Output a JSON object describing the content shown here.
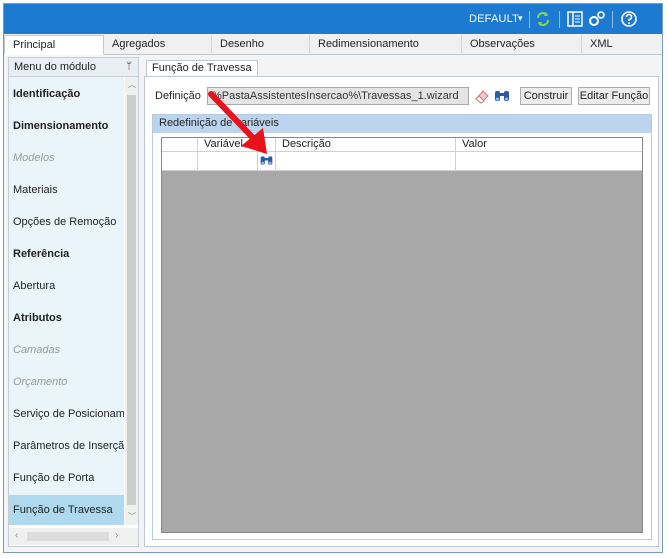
{
  "titlebar": {
    "profile": "DEFAULT",
    "caret": "▾",
    "icons": [
      "refresh-icon",
      "panel-icon",
      "settings-icon",
      "help-icon"
    ],
    "accent": "#1d7ad1"
  },
  "tabs": [
    {
      "label": "Principal",
      "active": true
    },
    {
      "label": "Agregados"
    },
    {
      "label": "Desenho"
    },
    {
      "label": "Redimensionamento"
    },
    {
      "label": "Observações"
    },
    {
      "label": "XML"
    }
  ],
  "sidebar": {
    "title": "Menu do módulo",
    "pin": "ᛘ",
    "items": [
      {
        "label": "Identificação",
        "style": "bold"
      },
      {
        "label": "Dimensionamento",
        "style": "bold"
      },
      {
        "label": "Modelos",
        "style": "disabled"
      },
      {
        "label": "Materiais"
      },
      {
        "label": "Opções de Remoção"
      },
      {
        "label": "Referência",
        "style": "bold"
      },
      {
        "label": "Abertura"
      },
      {
        "label": "Atributos",
        "style": "bold"
      },
      {
        "label": "Camadas",
        "style": "disabled"
      },
      {
        "label": "Orçamento",
        "style": "disabled"
      },
      {
        "label": "Serviço de Posicionamento"
      },
      {
        "label": "Parâmetros de Inserção"
      },
      {
        "label": "Função de Porta"
      },
      {
        "label": "Função de Travessa",
        "style": "selected"
      }
    ],
    "scroll_left": "‹",
    "scroll_right": "›",
    "scroll_up": "︿",
    "scroll_down": "﹀"
  },
  "main": {
    "subtab": "Função de Travessa",
    "definition_label": "Definição",
    "definition_value": "%PastaAssistentesInsercao%\\Travessas_1.wizard",
    "build_button": "Construir",
    "edit_button": "Editar Função",
    "group_title": "Redefinição de variáveis",
    "columns": [
      "",
      "Variável",
      "",
      "Descrição",
      "Valor"
    ]
  }
}
